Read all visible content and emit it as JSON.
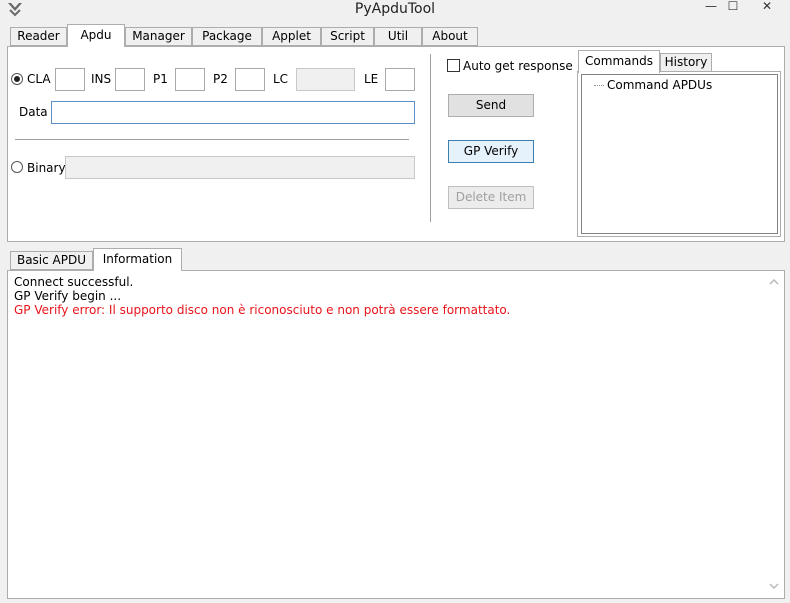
{
  "window": {
    "title": "PyApduTool",
    "controls": {
      "minimize": "—",
      "maximize": "☐",
      "close": "✕"
    }
  },
  "top_tabs": [
    {
      "label": "Reader",
      "active": false
    },
    {
      "label": "Apdu",
      "active": true
    },
    {
      "label": "Manager",
      "active": false
    },
    {
      "label": "Package",
      "active": false
    },
    {
      "label": "Applet",
      "active": false
    },
    {
      "label": "Script",
      "active": false
    },
    {
      "label": "Util",
      "active": false
    },
    {
      "label": "About",
      "active": false
    }
  ],
  "apdu": {
    "cla_label": "CLA",
    "ins_label": "INS",
    "p1_label": "P1",
    "p2_label": "P2",
    "lc_label": "LC",
    "le_label": "LE",
    "data_label": "Data",
    "binary_label": "Binary",
    "cla_value": "",
    "ins_value": "",
    "p1_value": "",
    "p2_value": "",
    "lc_value": "",
    "le_value": "",
    "data_value": "",
    "binary_value": "",
    "mode": "CLA"
  },
  "actions": {
    "auto_get_response_label": "Auto get response",
    "auto_get_response_checked": false,
    "send_label": "Send",
    "gp_verify_label": "GP Verify",
    "delete_item_label": "Delete Item"
  },
  "side_tabs": [
    {
      "label": "Commands",
      "active": true
    },
    {
      "label": "History",
      "active": false
    }
  ],
  "tree": {
    "root_label": "Command APDUs"
  },
  "bottom_tabs": [
    {
      "label": "Basic APDU",
      "active": false
    },
    {
      "label": "Information",
      "active": true
    }
  ],
  "log": [
    {
      "text": "Connect successful.",
      "color": "#000000"
    },
    {
      "text": "GP Verify begin ...",
      "color": "#000000"
    },
    {
      "text": "GP Verify error: Il supporto disco non è riconosciuto e non potrà essere formattato.",
      "color": "#e8141b"
    }
  ],
  "colors": {
    "error": "#e8141b",
    "focus_border": "#3c7fb1"
  }
}
